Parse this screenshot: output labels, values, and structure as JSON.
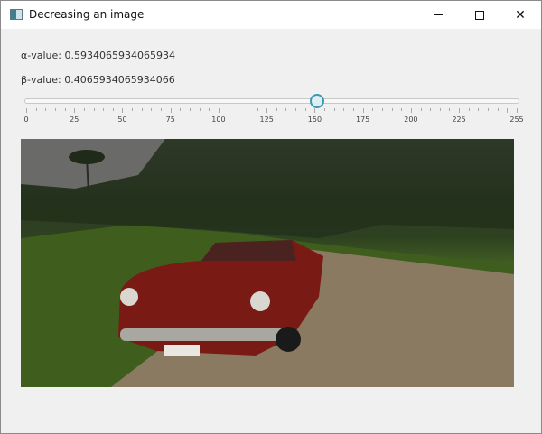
{
  "window": {
    "title": "Decreasing an image",
    "controls": [
      "minimize",
      "maximize",
      "close"
    ]
  },
  "labels": {
    "alpha": "α-value: 0.5934065934065934",
    "beta": "β-value: 0.4065934065934066"
  },
  "slider": {
    "min": 0,
    "max": 255,
    "value": 151.3,
    "tick_labels": [
      "0",
      "25",
      "50",
      "75",
      "100",
      "125",
      "150",
      "175",
      "200",
      "225",
      "255"
    ],
    "accent": "#3a9bb0"
  },
  "image": {
    "description_icon": "red-convertible-car-photo"
  }
}
